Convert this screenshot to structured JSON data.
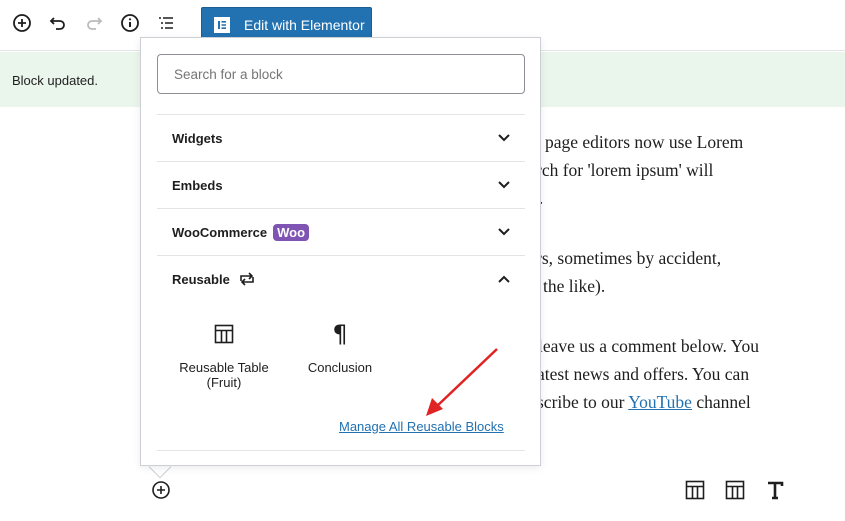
{
  "toolbar": {
    "edit_elementor_label": "Edit with Elementor",
    "icons": [
      "add-block-icon",
      "undo-icon",
      "redo-icon",
      "info-icon",
      "outline-icon"
    ]
  },
  "notice": {
    "text": "Block updated."
  },
  "content": {
    "lines": [
      "page editors now use Lorem",
      "rch for 'lorem ipsum' will",
      "/.",
      "rs, sometimes by accident,",
      "the like).",
      "leave us a comment below. You",
      "atest news and offers. You can",
      "scribe to our"
    ],
    "link": "YouTube",
    "after_link": " channel"
  },
  "inserter": {
    "search_placeholder": "Search for a block",
    "sections": [
      {
        "label": "Widgets",
        "expanded": false
      },
      {
        "label": "Embeds",
        "expanded": false
      },
      {
        "label": "WooCommerce",
        "badge": "Woo",
        "expanded": false
      },
      {
        "label": "Reusable",
        "expanded": true
      }
    ],
    "reusable_blocks": [
      {
        "label": "Reusable Table (Fruit)",
        "icon": "table-icon"
      },
      {
        "label": "Conclusion",
        "icon": "paragraph-icon"
      }
    ],
    "manage_link": "Manage All Reusable Blocks"
  },
  "bottom_toolbar": {
    "icons": [
      "table-icon",
      "table-icon",
      "heading-icon"
    ]
  },
  "colors": {
    "accent": "#2271b1",
    "notice_bg": "#eaf6ec",
    "woo": "#7f54b3",
    "arrow": "#e02424"
  }
}
